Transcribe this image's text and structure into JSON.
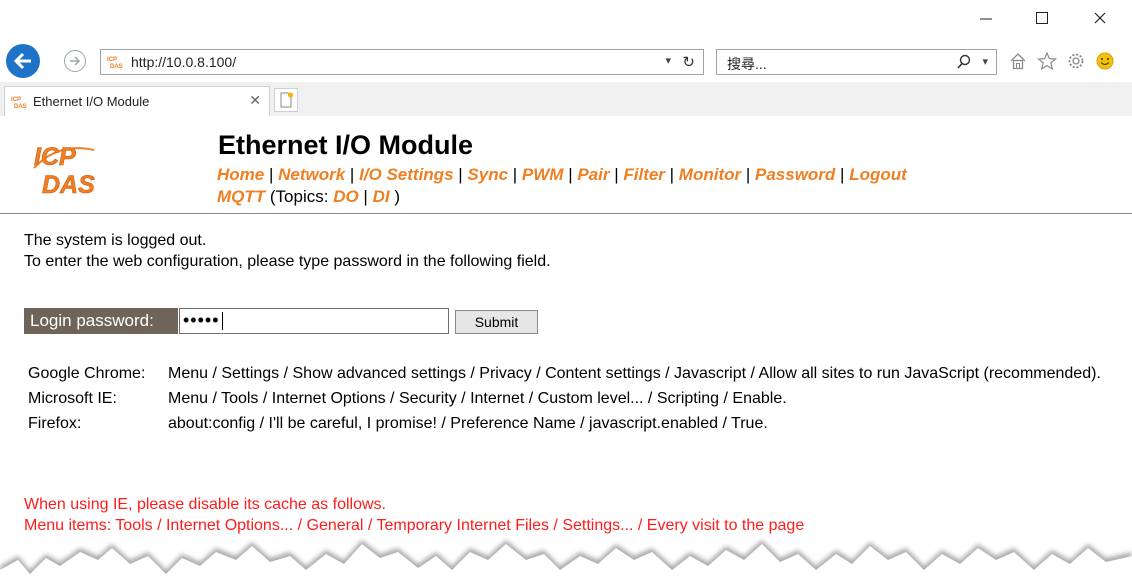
{
  "browser": {
    "url": "http://10.0.8.100/",
    "search_placeholder": "搜尋...",
    "tab_title": "Ethernet I/O Module",
    "window_buttons": [
      "minimize-icon",
      "maximize-icon",
      "close-icon"
    ],
    "toolbar_icons": [
      "home-icon",
      "favorites-star-icon",
      "settings-gear-icon",
      "smiley-feedback-icon"
    ]
  },
  "page": {
    "logo_text": [
      "ICP",
      "DAS"
    ],
    "title": "Ethernet I/O Module",
    "nav": [
      "Home",
      "Network",
      "I/O Settings",
      "Sync",
      "PWM",
      "Pair",
      "Filter",
      "Monitor",
      "Password",
      "Logout"
    ],
    "mqtt": {
      "label": "MQTT",
      "topics_prefix": "(Topics:",
      "do": "DO",
      "di": "DI",
      "close": ")"
    },
    "status_message": "The system is logged out.",
    "instruction": "To enter the web configuration, please type password in the following field.",
    "login_label": "Login password:",
    "password_value": "•••••",
    "submit_label": "Submit",
    "browsers": [
      {
        "name": "Google Chrome:",
        "path": "Menu / Settings / Show advanced settings / Privacy / Content settings / Javascript / Allow all sites to run JavaScript (recommended)."
      },
      {
        "name": "Microsoft IE:",
        "path": "Menu / Tools / Internet Options / Security / Internet / Custom level... / Scripting / Enable."
      },
      {
        "name": "Firefox:",
        "path": "about:config / I'll be careful, I promise! / Preference Name / javascript.enabled / True."
      }
    ],
    "ie_warning_1": "When using IE, please disable its cache as follows.",
    "ie_warning_2": "Menu items: Tools / Internet Options... / General / Temporary Internet Files / Settings... / Every visit to the page"
  },
  "colors": {
    "nav_link": "#f07f22",
    "warning": "#ff1c1c",
    "login_label_bg": "#6e6459",
    "back_button": "#1e73c9"
  }
}
